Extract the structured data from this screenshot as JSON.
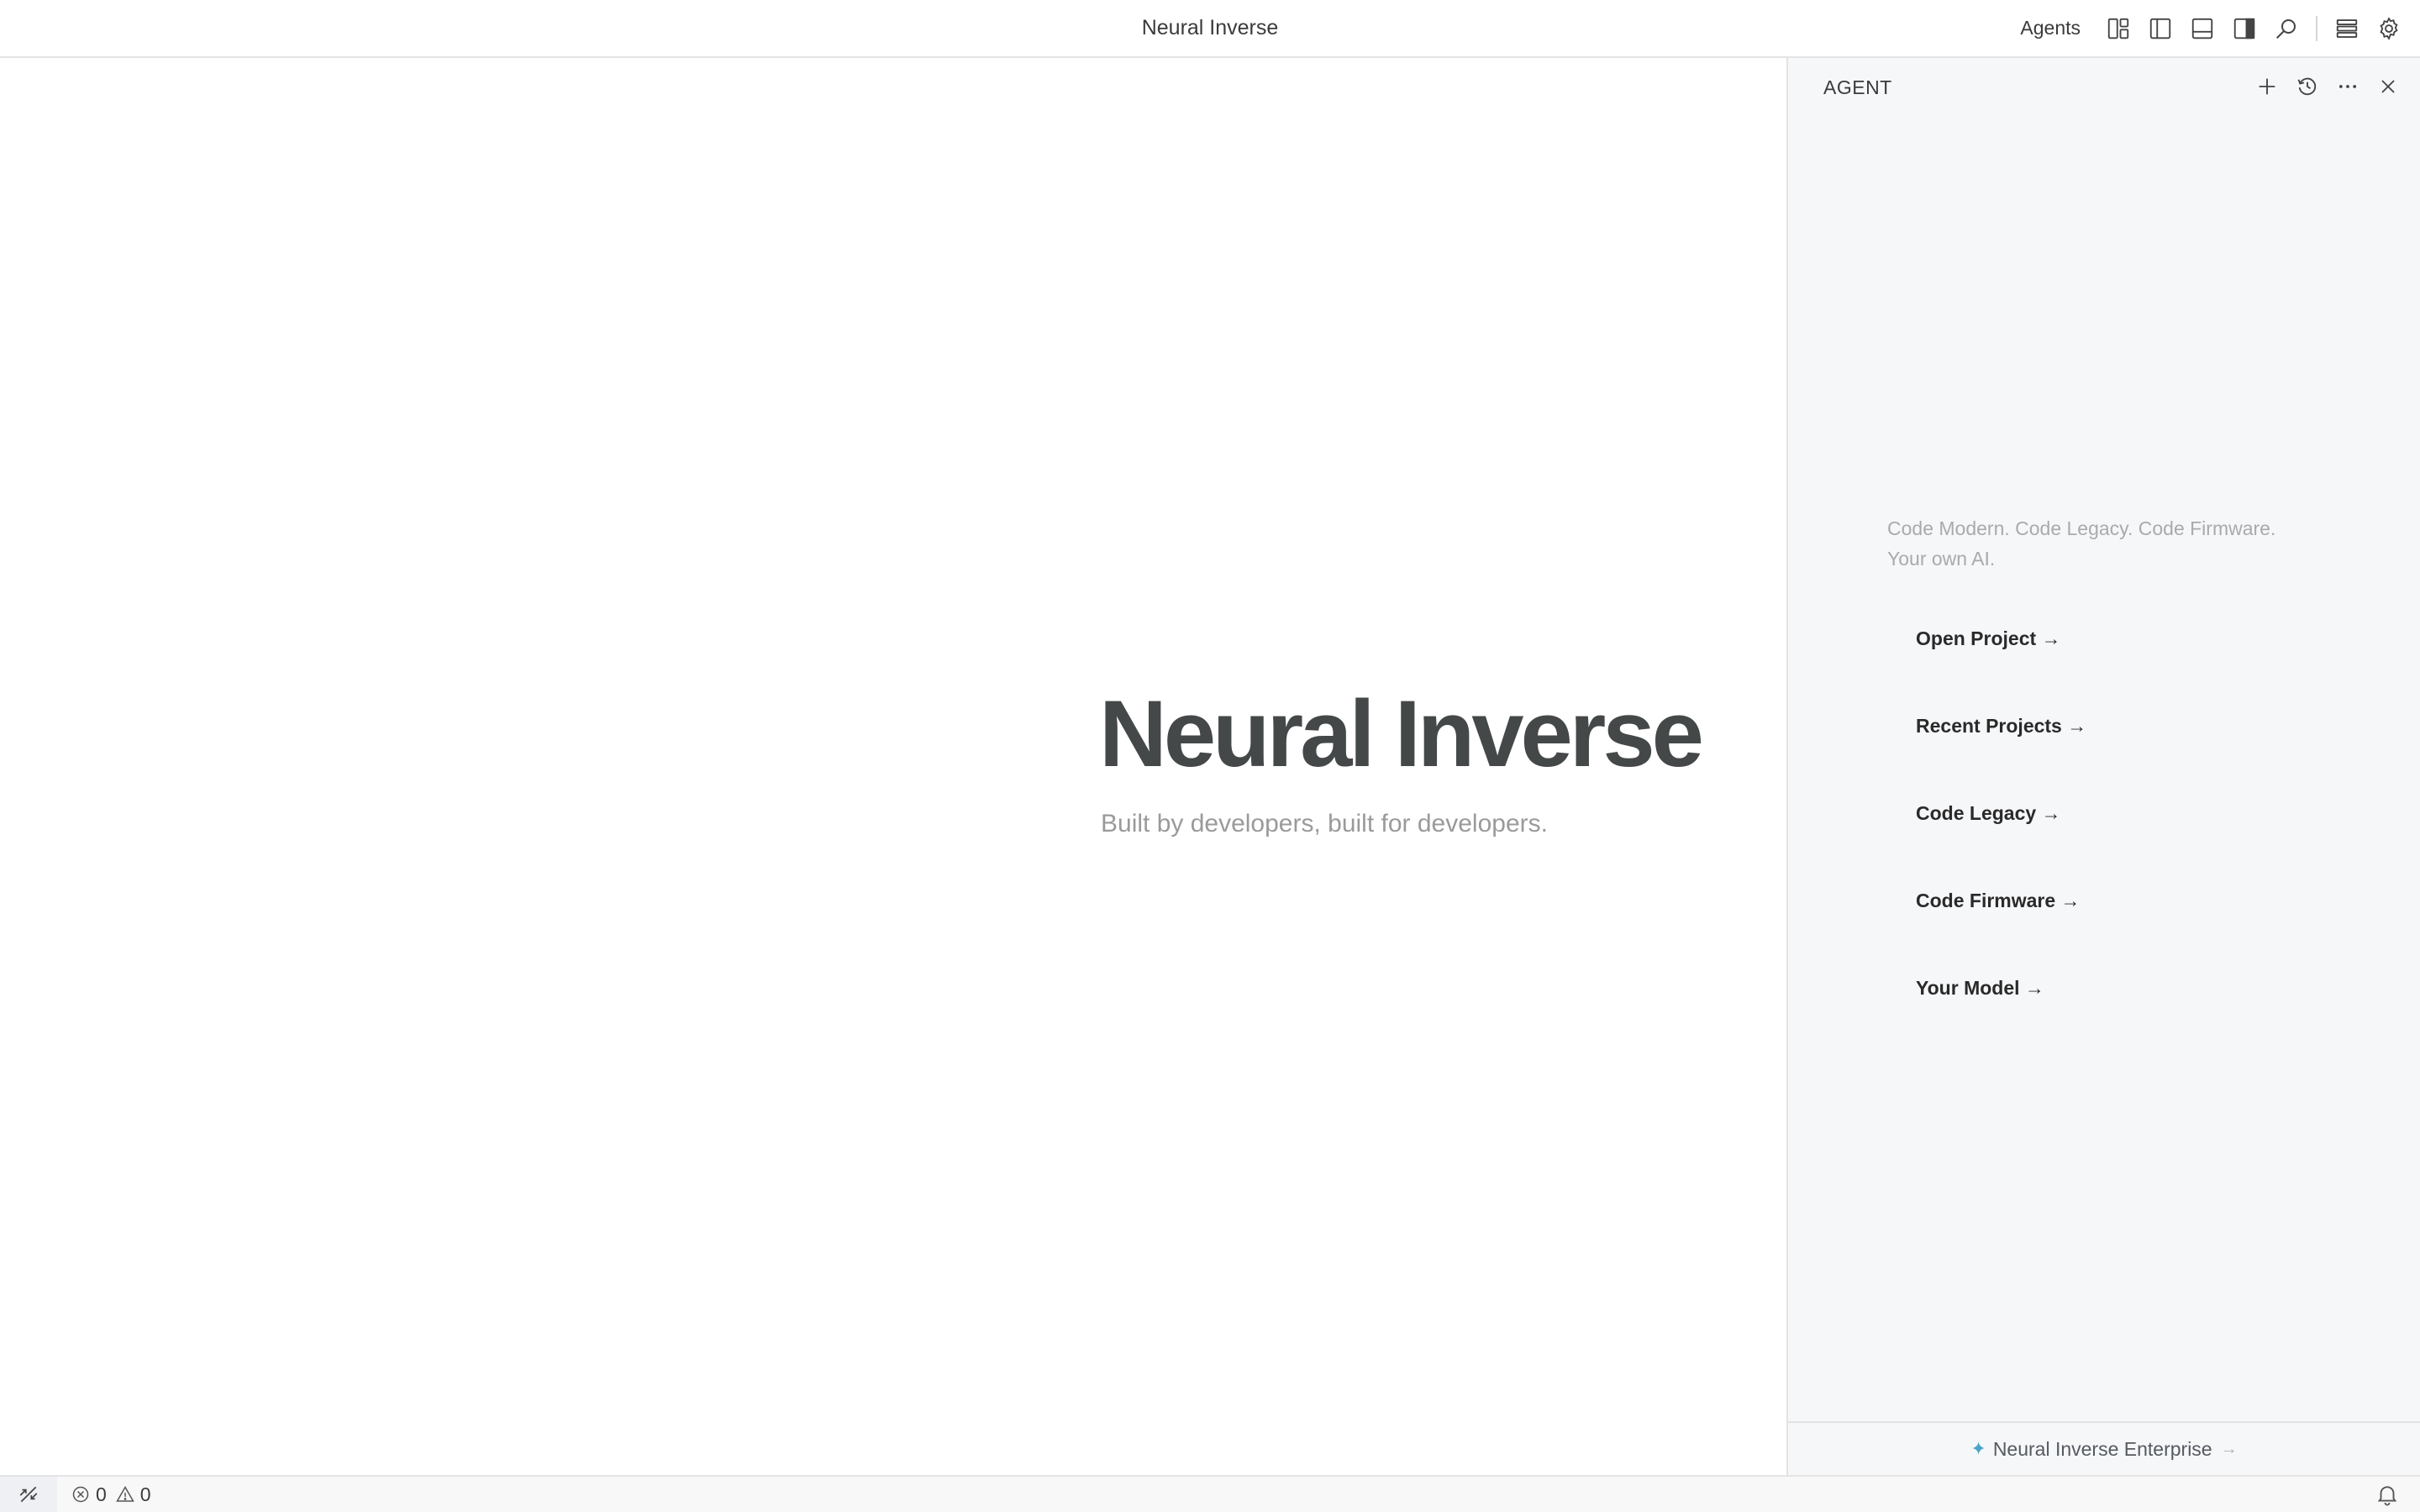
{
  "titlebar": {
    "title": "Neural Inverse",
    "agents_label": "Agents",
    "icons": [
      "customize-layout-icon",
      "toggle-primary-sidebar-icon",
      "toggle-panel-icon",
      "toggle-secondary-sidebar-icon",
      "search-icon",
      "accounts-list-icon",
      "gear-icon"
    ]
  },
  "editor": {
    "hero_title": "Neural Inverse",
    "hero_subtitle": "Built by developers, built for developers."
  },
  "agent_panel": {
    "title": "AGENT",
    "header_icons": [
      "plus-icon",
      "history-icon",
      "more-icon",
      "close-icon"
    ],
    "tagline_line1": "Code Modern. Code Legacy. Code Firmware.",
    "tagline_line2": "Your own AI.",
    "links": [
      {
        "label": "Open Project →"
      },
      {
        "label": "Recent Projects →"
      },
      {
        "label": "Code Legacy →"
      },
      {
        "label": "Code Firmware →"
      },
      {
        "label": "Your Model →"
      }
    ],
    "footer": {
      "sparkle": "✦",
      "label": "Neural Inverse Enterprise",
      "arrow": "→"
    }
  },
  "statusbar": {
    "errors": "0",
    "warnings": "0"
  },
  "colors": {
    "panel_bg": "#f6f7f9",
    "accent": "#4aa4c8",
    "hero_text": "#454848"
  }
}
